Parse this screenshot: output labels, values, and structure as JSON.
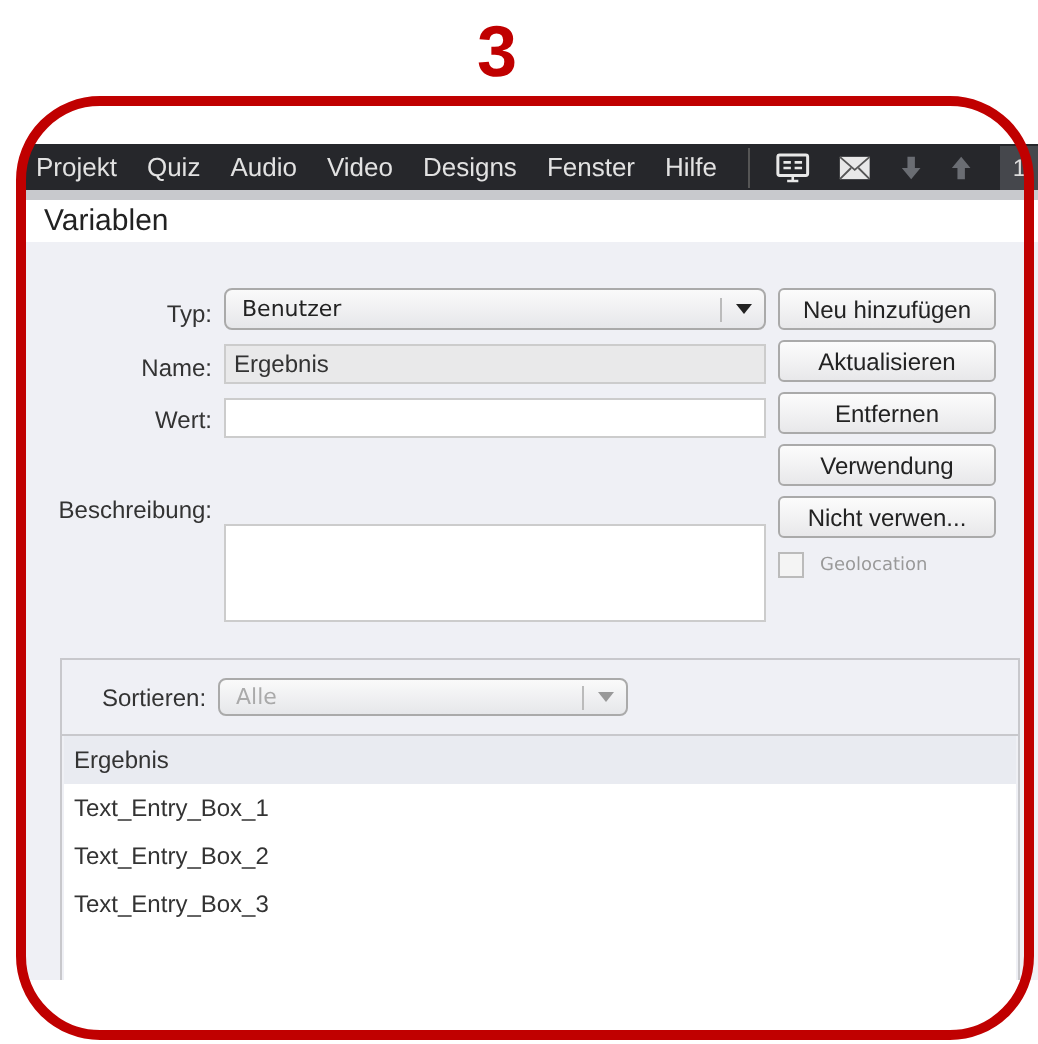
{
  "annotation": {
    "step": "3"
  },
  "menubar": {
    "items": [
      "Projekt",
      "Quiz",
      "Audio",
      "Video",
      "Designs",
      "Fenster",
      "Hilfe"
    ],
    "page": "1"
  },
  "panel": {
    "title": "Variablen"
  },
  "form": {
    "type": {
      "label": "Typ:",
      "value": "Benutzer"
    },
    "name": {
      "label": "Name:",
      "value": "Ergebnis",
      "disabled": true
    },
    "value": {
      "label": "Wert:"
    },
    "description": {
      "label": "Beschreibung:"
    }
  },
  "buttons": [
    "Neu hinzufügen",
    "Aktualisieren",
    "Entfernen",
    "Verwendung",
    "Nicht verwen..."
  ],
  "geolocation": {
    "label": "Geolocation",
    "checked": false,
    "disabled": true
  },
  "sort": {
    "label": "Sortieren:",
    "value": "Alle",
    "disabled": true
  },
  "variables": [
    {
      "name": "Ergebnis",
      "selected": true
    },
    {
      "name": "Text_Entry_Box_1",
      "selected": false
    },
    {
      "name": "Text_Entry_Box_2",
      "selected": false
    },
    {
      "name": "Text_Entry_Box_3",
      "selected": false
    }
  ]
}
